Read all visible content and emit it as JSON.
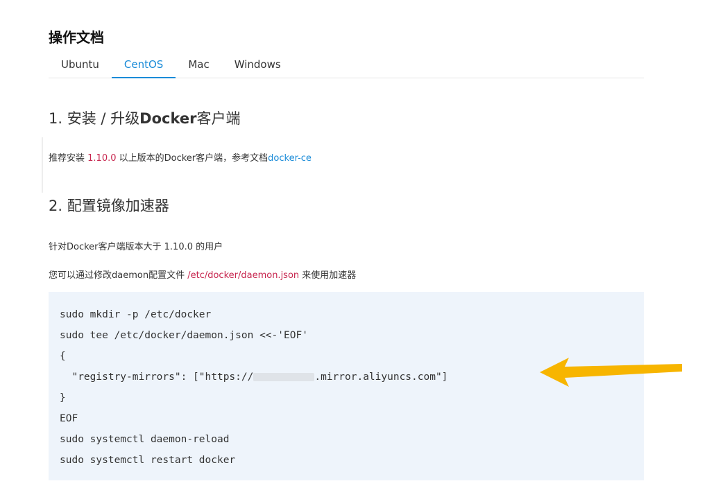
{
  "doc_title": "操作文档",
  "tabs": [
    {
      "label": "Ubuntu",
      "active": false
    },
    {
      "label": "CentOS",
      "active": true
    },
    {
      "label": "Mac",
      "active": false
    },
    {
      "label": "Windows",
      "active": false
    }
  ],
  "section1": {
    "heading_prefix": "1. 安装 / 升级",
    "heading_bold": "Docker",
    "heading_suffix": "客户端",
    "text_before": "推荐安装 ",
    "version": "1.10.0",
    "text_middle": " 以上版本的Docker客户端，参考文档",
    "link": "docker-ce"
  },
  "section2": {
    "heading": "2. 配置镜像加速器",
    "line1": "针对Docker客户端版本大于 1.10.0 的用户",
    "line2_before": "您可以通过修改daemon配置文件 ",
    "line2_path": "/etc/docker/daemon.json",
    "line2_after": " 来使用加速器"
  },
  "code": {
    "line1": "sudo mkdir -p /etc/docker",
    "line2": "sudo tee /etc/docker/daemon.json <<-'EOF'",
    "line3": "{",
    "line4_before": "  \"registry-mirrors\": [\"https://",
    "line4_after": ".mirror.aliyuncs.com\"]",
    "line5": "}",
    "line6": "EOF",
    "line7": "sudo systemctl daemon-reload",
    "line8": "sudo systemctl restart docker"
  },
  "colors": {
    "accent": "#1a8bd8",
    "highlight_red": "#c7254e",
    "code_bg": "#eef4fb",
    "arrow": "#f7b500"
  },
  "icons": {
    "annotation_arrow": "arrow-left-icon"
  }
}
